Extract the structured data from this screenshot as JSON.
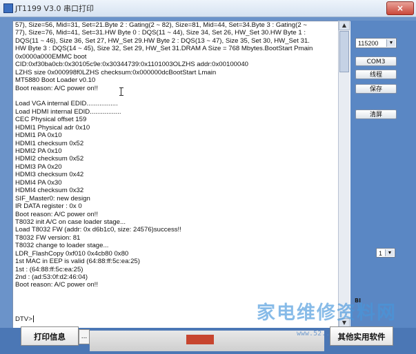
{
  "window": {
    "title": "JT1199 V3.0 串口打印",
    "close_label": "×"
  },
  "console": {
    "lines": [
      "57), Size=56, Mid=31, Set=21.Byte 2 : Gating(2 ~ 82), Size=81, Mid=44, Set=34.Byte 3 : Gating(2 ~",
      "77), Size=76, Mid=41, Set=31.HW Byte 0 : DQS(11 ~ 44), Size 34, Set 26, HW_Set 30.HW Byte 1 :",
      "DQS(11 ~ 46), Size 36, Set 27, HW_Set 29.HW Byte 2 : DQS(13 ~ 47), Size 35, Set 30, HW_Set 31.",
      "HW Byte 3 : DQS(14 ~ 45), Size 32, Set 29, HW_Set 31.DRAM A Size = 768 Mbytes.BootStart Pmain",
      "0x0000a000EMMC boot",
      "CID:0xf30ba0cb:0x30105c9e:0x30344739:0x1101003OLZHS  addr:0x00100040",
      "LZHS size 0x000998f0LZHS checksum:0x000000dcBootStart Lmain",
      "MT5880 Boot Loader v0.10",
      "Boot reason: A/C power on!!",
      "",
      "Load VGA internal EDID.................",
      " Load HDMI internal EDID.................",
      " CEC Physical offset 159",
      "HDMI1 Physical adr 0x10",
      "HDMI1 PA 0x10",
      "HDMI1 checksum 0x52",
      "HDMI2 PA 0x10",
      "HDMI2 checksum 0x52",
      "HDMI3 PA 0x20",
      "HDMI3 checksum 0x42",
      "HDMI4 PA 0x30",
      "HDMI4 checksum 0x32",
      "SIF_Master0: new design",
      "IR DATA register : 0x       0",
      "Boot reason: A/C power on!!",
      "T8032 init A/C on case loader stage...",
      "Load T8032 FW (addr: 0x  d6b1c0, size: 24576)success!!",
      "T8032 FW version: 81",
      "T8032 change to loader stage...",
      "LDR_FlashCopy 0xf010 0x4cb80 0x80",
      "1st MAC in EEP is valid (64:88:ff:5c:ea:25)",
      "1st : (64:88:ff:5c:ea:25)",
      "2nd : (ad:53:0f:d2:46:04)",
      "Boot reason: A/C power on!!"
    ],
    "prompt": "DTV>"
  },
  "side_panel": {
    "baud_rate": "115200",
    "port_button": "COM3",
    "clear_line_button": "线程",
    "save_button": "保存",
    "clear_screen_button": "清屏",
    "page_select": "1"
  },
  "bottom": {
    "print_info_button": "打印信息",
    "ellipsis_label": "...",
    "other_tools_button": "其他实用软件",
    "corner_label": "BI"
  },
  "watermark": {
    "text": "家电维修资料网",
    "url": "www.52.."
  }
}
